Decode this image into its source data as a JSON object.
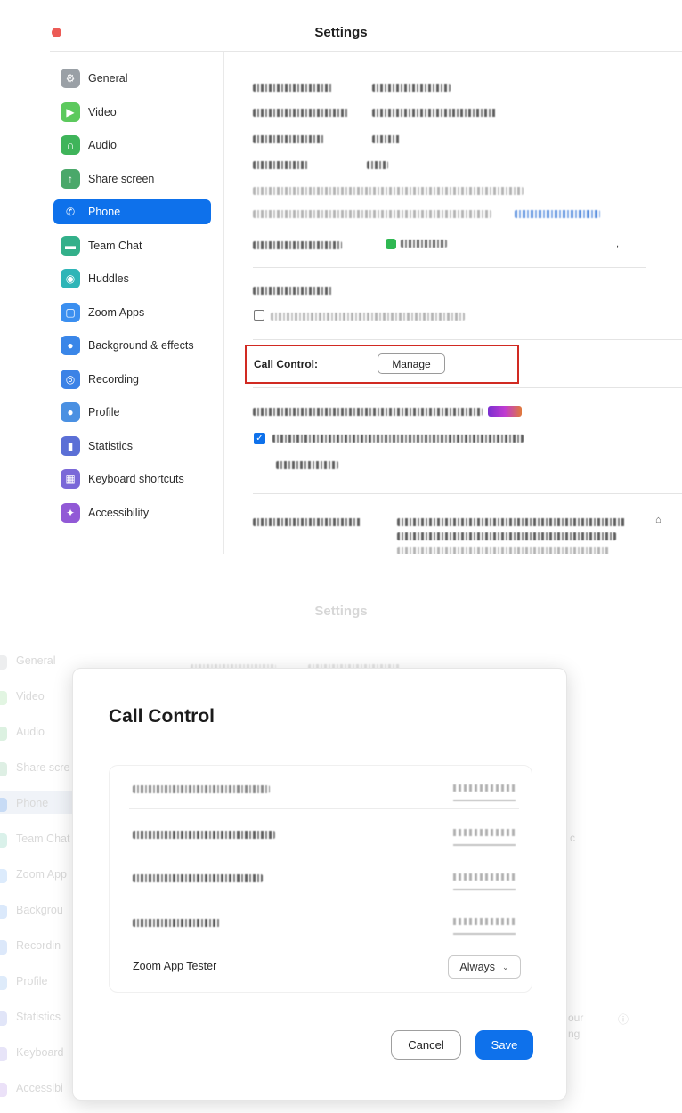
{
  "window": {
    "title": "Settings"
  },
  "sidebar": {
    "items": [
      {
        "label": "General",
        "icon": "gear-icon",
        "color": "#9aa0a6",
        "active": false
      },
      {
        "label": "Video",
        "icon": "video-camera-icon",
        "color": "#5cc95d",
        "active": false
      },
      {
        "label": "Audio",
        "icon": "headphones-icon",
        "color": "#3fb45a",
        "active": false
      },
      {
        "label": "Share screen",
        "icon": "share-screen-icon",
        "color": "#4aa86a",
        "active": false
      },
      {
        "label": "Phone",
        "icon": "phone-icon",
        "color": "#0e71eb",
        "active": true
      },
      {
        "label": "Team Chat",
        "icon": "chat-bubble-icon",
        "color": "#33b08a",
        "active": false
      },
      {
        "label": "Huddles",
        "icon": "huddles-icon",
        "color": "#2eb5b7",
        "active": false
      },
      {
        "label": "Zoom Apps",
        "icon": "apps-icon",
        "color": "#3b8ff0",
        "active": false
      },
      {
        "label": "Background & effects",
        "icon": "person-background-icon",
        "color": "#3a86e8",
        "active": false
      },
      {
        "label": "Recording",
        "icon": "record-icon",
        "color": "#3b82e6",
        "active": false
      },
      {
        "label": "Profile",
        "icon": "profile-icon",
        "color": "#4a90e2",
        "active": false
      },
      {
        "label": "Statistics",
        "icon": "bar-chart-icon",
        "color": "#5b6fd6",
        "active": false
      },
      {
        "label": "Keyboard shortcuts",
        "icon": "keyboard-icon",
        "color": "#7a68d8",
        "active": false
      },
      {
        "label": "Accessibility",
        "icon": "accessibility-icon",
        "color": "#9159d6",
        "active": false
      }
    ]
  },
  "phone_settings": {
    "call_control_label": "Call Control:",
    "manage_label": "Manage"
  },
  "background": {
    "title": "Settings",
    "items": [
      "General",
      "Video",
      "Audio",
      "Share scre",
      "Phone",
      "Team Chat",
      "Zoom App",
      "Backgrou",
      "Recordin",
      "Profile",
      "Statistics",
      "Keyboard",
      "Accessibi"
    ],
    "side_snippets": [
      "our",
      "ng"
    ]
  },
  "modal": {
    "title": "Call Control",
    "tester_label": "Zoom App Tester",
    "tester_value": "Always",
    "cancel_label": "Cancel",
    "save_label": "Save"
  },
  "colors": {
    "accent": "#0e71eb",
    "highlight_border": "#d12a22",
    "close_dot": "#ec5b56"
  }
}
